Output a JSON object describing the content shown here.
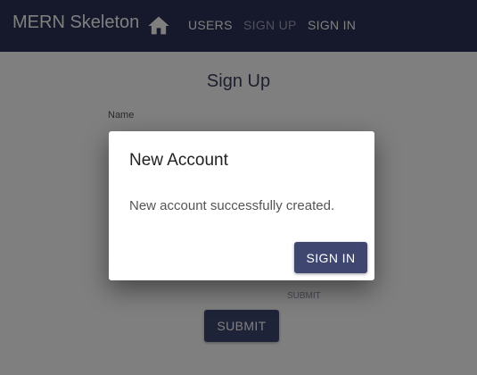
{
  "appbar": {
    "title": "MERN Skeleton",
    "home_icon": "home-icon",
    "nav": {
      "users": "USERS",
      "signup": "SIGN UP",
      "signin": "SIGN IN"
    },
    "color": "#2c3157"
  },
  "signup_form": {
    "title": "Sign Up",
    "name_label": "Name",
    "ghost_label": "SUBMIT",
    "submit_label": "SUBMIT"
  },
  "dialog": {
    "title": "New Account",
    "message": "New account successfully created.",
    "button_label": "SIGN IN"
  }
}
